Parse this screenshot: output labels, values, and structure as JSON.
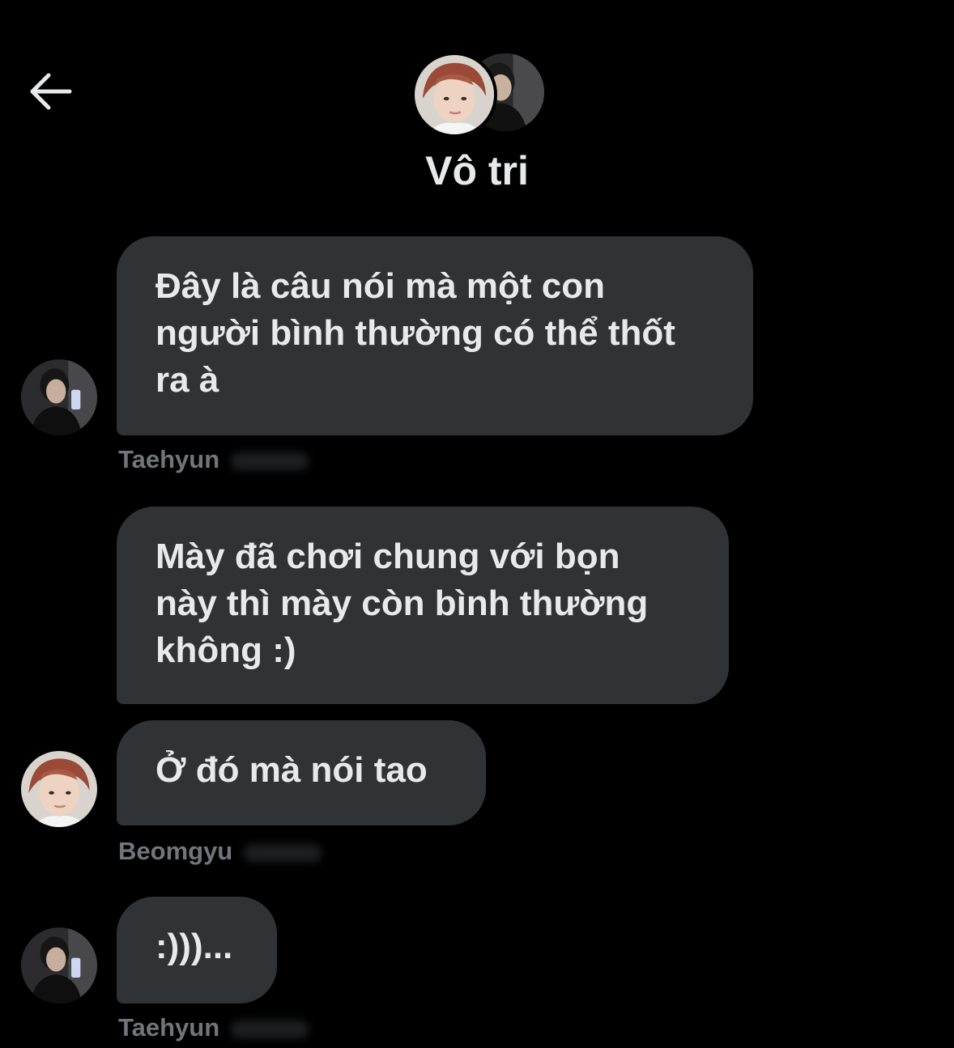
{
  "header": {
    "back_icon": "arrow-left-icon",
    "title": "Vô tri"
  },
  "messages": [
    {
      "sender": "Taehyun",
      "lines": [
        "Đây là câu nói mà một con",
        "người bình thường có thể thốt",
        "ra à"
      ]
    },
    {
      "sender": "",
      "lines": [
        "Mày đã chơi chung với bọn",
        "này thì mày còn bình thường",
        "không :)"
      ]
    },
    {
      "sender": "Beomgyu",
      "lines": [
        "Ở đó mà nói tao"
      ]
    },
    {
      "sender": "Taehyun",
      "lines": [
        ":)))..."
      ]
    }
  ],
  "colors": {
    "background": "#000000",
    "bubble": "#2f3336",
    "text": "#e7e9ea",
    "secondary_text": "#71767b"
  }
}
